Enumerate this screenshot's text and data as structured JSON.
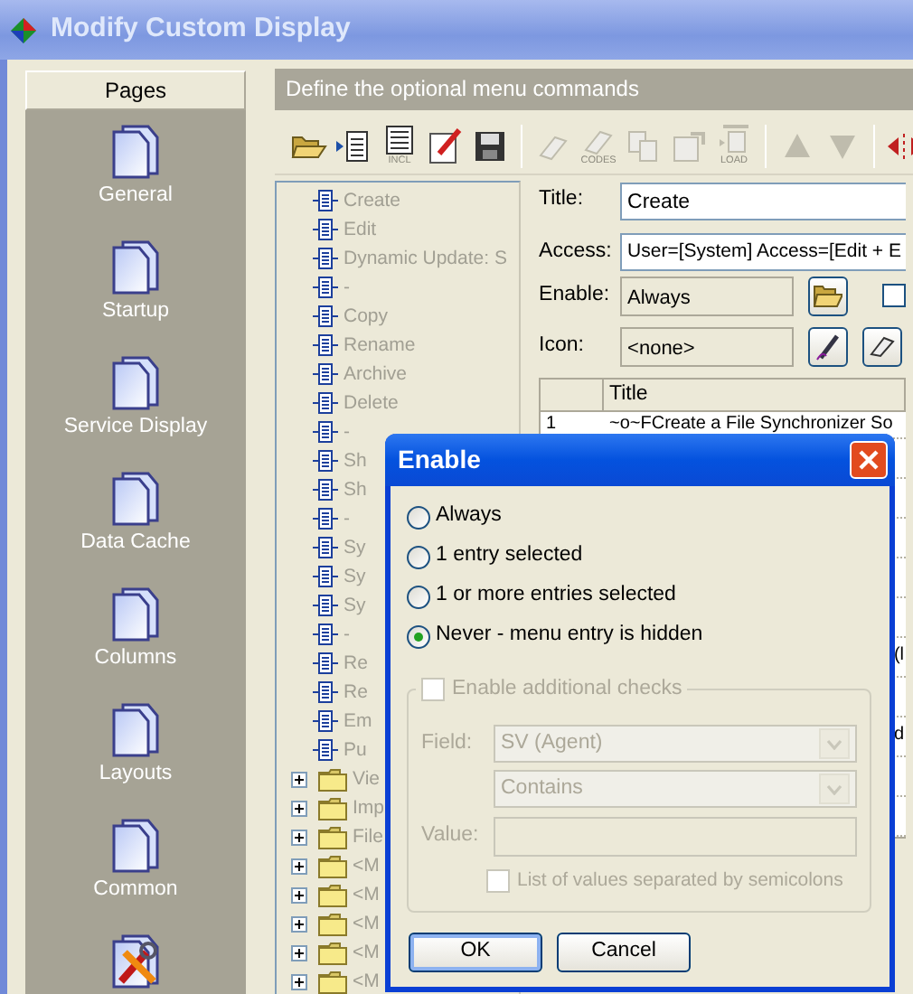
{
  "window": {
    "title": "Modify Custom Display"
  },
  "pages": {
    "header": "Pages",
    "items": [
      {
        "kind": "page",
        "label": "General"
      },
      {
        "kind": "page",
        "label": "Startup"
      },
      {
        "kind": "page",
        "label": "Service Display"
      },
      {
        "kind": "page",
        "label": "Data Cache"
      },
      {
        "kind": "page",
        "label": "Columns"
      },
      {
        "kind": "page",
        "label": "Layouts"
      },
      {
        "kind": "page",
        "label": "Common"
      },
      {
        "kind": "tools"
      }
    ]
  },
  "section_header": "Define the optional menu commands",
  "toolbar": [
    {
      "kind": "open",
      "disabled": false
    },
    {
      "kind": "insert",
      "disabled": false
    },
    {
      "kind": "include",
      "disabled": false,
      "caption": "INCL"
    },
    {
      "kind": "edit",
      "disabled": false
    },
    {
      "kind": "save",
      "disabled": false
    },
    {
      "kind": "separator"
    },
    {
      "kind": "erase",
      "disabled": true
    },
    {
      "kind": "erase-codes",
      "disabled": true,
      "caption": "CODES"
    },
    {
      "kind": "copy",
      "disabled": true
    },
    {
      "kind": "properties",
      "disabled": true
    },
    {
      "kind": "load",
      "disabled": true,
      "caption": "LOAD"
    },
    {
      "kind": "separator"
    },
    {
      "kind": "up",
      "disabled": true
    },
    {
      "kind": "down",
      "disabled": true
    },
    {
      "kind": "separator"
    },
    {
      "kind": "split",
      "disabled": false
    }
  ],
  "tree": [
    {
      "kind": "leaf",
      "label": "Create"
    },
    {
      "kind": "leaf",
      "label": "Edit"
    },
    {
      "kind": "leaf",
      "label": "Dynamic Update: S"
    },
    {
      "kind": "leaf",
      "label": "-"
    },
    {
      "kind": "leaf",
      "label": "Copy"
    },
    {
      "kind": "leaf",
      "label": "Rename"
    },
    {
      "kind": "leaf",
      "label": "Archive"
    },
    {
      "kind": "leaf",
      "label": "Delete"
    },
    {
      "kind": "leaf",
      "label": "-"
    },
    {
      "kind": "leaf",
      "label": "Sh"
    },
    {
      "kind": "leaf",
      "label": "Sh"
    },
    {
      "kind": "leaf",
      "label": "-"
    },
    {
      "kind": "leaf",
      "label": "Sy"
    },
    {
      "kind": "leaf",
      "label": "Sy"
    },
    {
      "kind": "leaf",
      "label": "Sy"
    },
    {
      "kind": "leaf",
      "label": "-"
    },
    {
      "kind": "leaf",
      "label": "Re"
    },
    {
      "kind": "leaf",
      "label": "Re"
    },
    {
      "kind": "leaf",
      "label": "Em"
    },
    {
      "kind": "leaf",
      "label": "Pu"
    },
    {
      "kind": "folder",
      "label": "Vie",
      "expanded": false
    },
    {
      "kind": "folder",
      "label": "Imp",
      "expanded": false
    },
    {
      "kind": "folder",
      "label": "File",
      "expanded": false
    },
    {
      "kind": "folder",
      "label": "<M",
      "expanded": false
    },
    {
      "kind": "folder",
      "label": "<M",
      "expanded": false
    },
    {
      "kind": "folder",
      "label": "<M",
      "expanded": false
    },
    {
      "kind": "folder",
      "label": "<M",
      "expanded": false
    },
    {
      "kind": "folder",
      "label": "<M",
      "expanded": false
    }
  ],
  "form": {
    "title": {
      "label": "Title:",
      "value": "Create"
    },
    "access": {
      "label": "Access:",
      "value": "User=[System] Access=[Edit + E"
    },
    "enable": {
      "label": "Enable:",
      "value": "Always",
      "checked": false
    },
    "icon": {
      "label": "Icon:",
      "value": "<none>"
    }
  },
  "table": {
    "columns": [
      "Title"
    ],
    "rows": [
      {
        "number": "1",
        "title": "~o~FCreate a File Synchronizer So"
      },
      {},
      {},
      {},
      {},
      {},
      {
        "title": "(l"
      },
      {},
      {
        "title": "d"
      },
      {},
      {}
    ]
  },
  "dialog": {
    "title": "Enable",
    "options": [
      {
        "label": "Always",
        "selected": false
      },
      {
        "label": "1 entry selected",
        "selected": false
      },
      {
        "label": "1 or more entries selected",
        "selected": false
      },
      {
        "label": "Never - menu entry is hidden",
        "selected": true
      }
    ],
    "checks": {
      "label": "Enable additional checks",
      "checked": false,
      "disabled": true,
      "field_label": "Field:",
      "field_value": "SV (Agent)",
      "operator_value": "Contains",
      "value_label": "Value:",
      "list_label": "List of values separated by semicolons",
      "list_checked": false
    },
    "buttons": [
      {
        "label": "OK",
        "default": true
      },
      {
        "label": "Cancel",
        "default": false
      }
    ]
  }
}
